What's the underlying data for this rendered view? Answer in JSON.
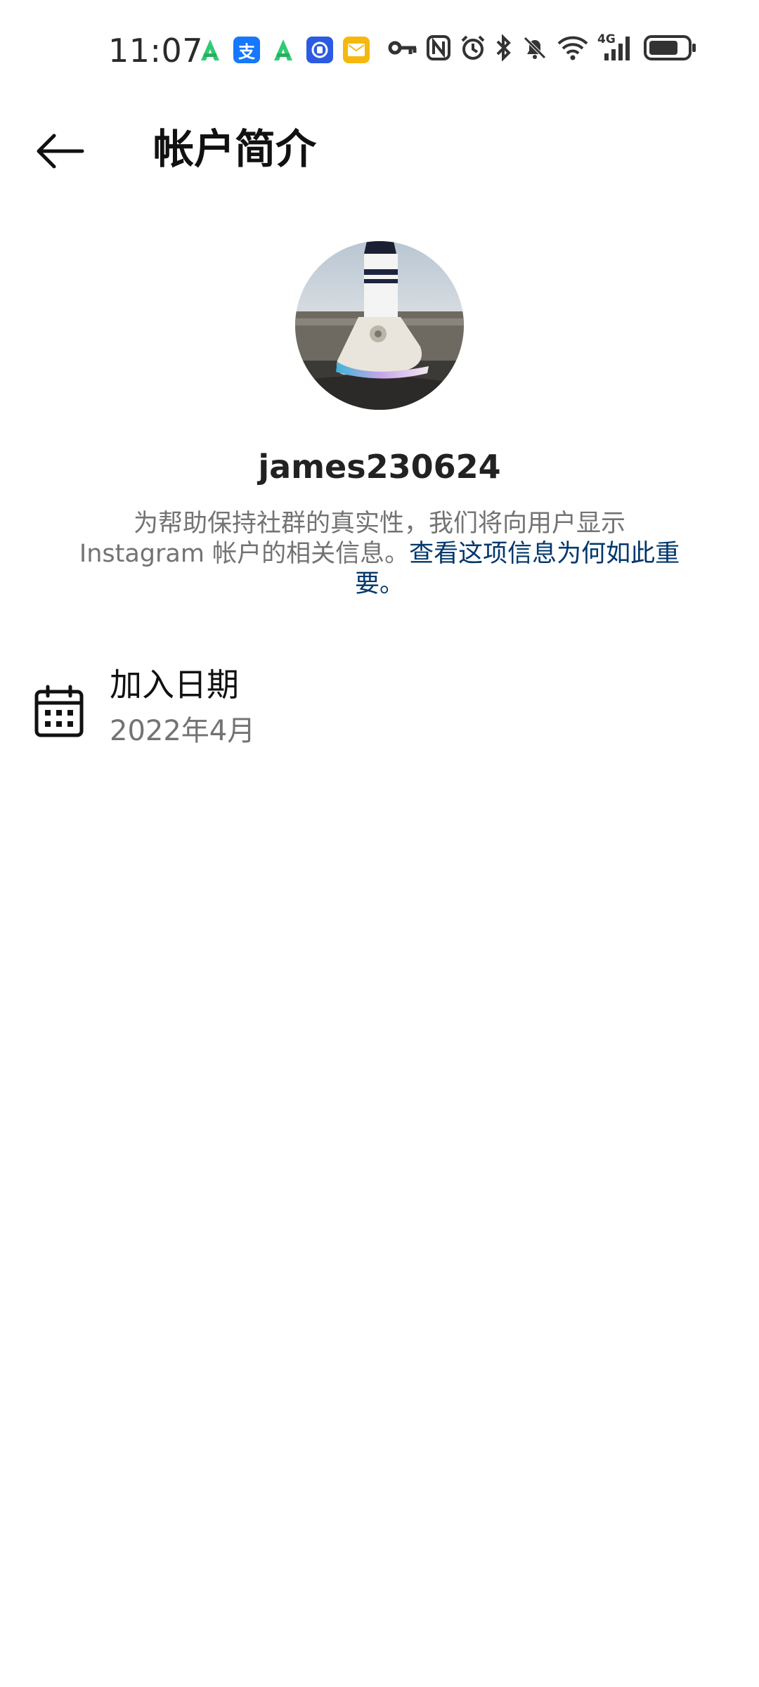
{
  "status_bar": {
    "time": "11:07",
    "network": "4G"
  },
  "header": {
    "title": "帐户简介"
  },
  "profile": {
    "username": "james230624",
    "info_text": "为帮助保持社群的真实性，我们将向用户显示 Instagram 帐户的相关信息。",
    "info_link": "查看这项信息为何如此重要。"
  },
  "joined": {
    "label": "加入日期",
    "value": "2022年4月"
  },
  "colors": {
    "link": "#00376b",
    "secondary_text": "#737373"
  },
  "icons": {
    "back": "arrow-left-icon",
    "calendar": "calendar-icon"
  }
}
